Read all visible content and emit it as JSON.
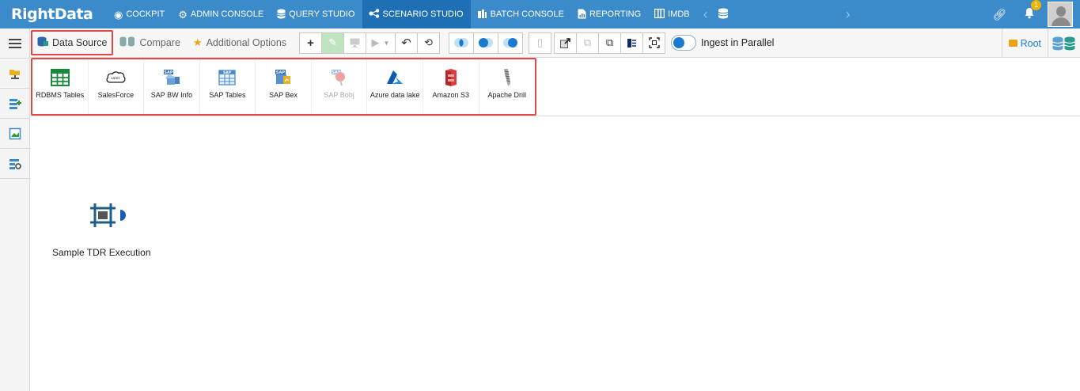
{
  "app": {
    "logo_text": "RightData"
  },
  "topnav": {
    "items": [
      {
        "label": "COCKPIT",
        "icon": "cockpit-icon"
      },
      {
        "label": "ADMIN CONSOLE",
        "icon": "gear-icon"
      },
      {
        "label": "QUERY STUDIO",
        "icon": "database-icon"
      },
      {
        "label": "SCENARIO STUDIO",
        "icon": "flow-icon",
        "active": true
      },
      {
        "label": "BATCH CONSOLE",
        "icon": "batch-icon"
      },
      {
        "label": "REPORTING",
        "icon": "report-icon"
      },
      {
        "label": "IMDB",
        "icon": "columns-icon"
      }
    ],
    "notifications_count": "1"
  },
  "toolbar": {
    "data_source_label": "Data Source",
    "compare_label": "Compare",
    "additional_options_label": "Additional Options",
    "ingest_label": "Ingest in Parallel",
    "root_label": "Root"
  },
  "sources": [
    {
      "label": "RDBMS Tables",
      "icon": "rdbms-table-icon",
      "enabled": true
    },
    {
      "label": "SalesForce",
      "icon": "salesforce-icon",
      "enabled": true
    },
    {
      "label": "SAP BW Info",
      "icon": "sap-bw-icon",
      "enabled": true
    },
    {
      "label": "SAP Tables",
      "icon": "sap-tables-icon",
      "enabled": true
    },
    {
      "label": "SAP Bex",
      "icon": "sap-bex-icon",
      "enabled": true
    },
    {
      "label": "SAP Bobj",
      "icon": "sap-bobj-icon",
      "enabled": false
    },
    {
      "label": "Azure data lake",
      "icon": "azure-icon",
      "enabled": true
    },
    {
      "label": "Amazon S3",
      "icon": "amazon-s3-icon",
      "enabled": true
    },
    {
      "label": "Apache Drill",
      "icon": "apache-drill-icon",
      "enabled": true
    }
  ],
  "canvas": {
    "node_label": "Sample TDR Execution"
  },
  "colors": {
    "nav_bg": "#3b8ac9",
    "nav_active": "#1e6fb3",
    "highlight": "#e04848",
    "accent": "#1a7ad0"
  }
}
